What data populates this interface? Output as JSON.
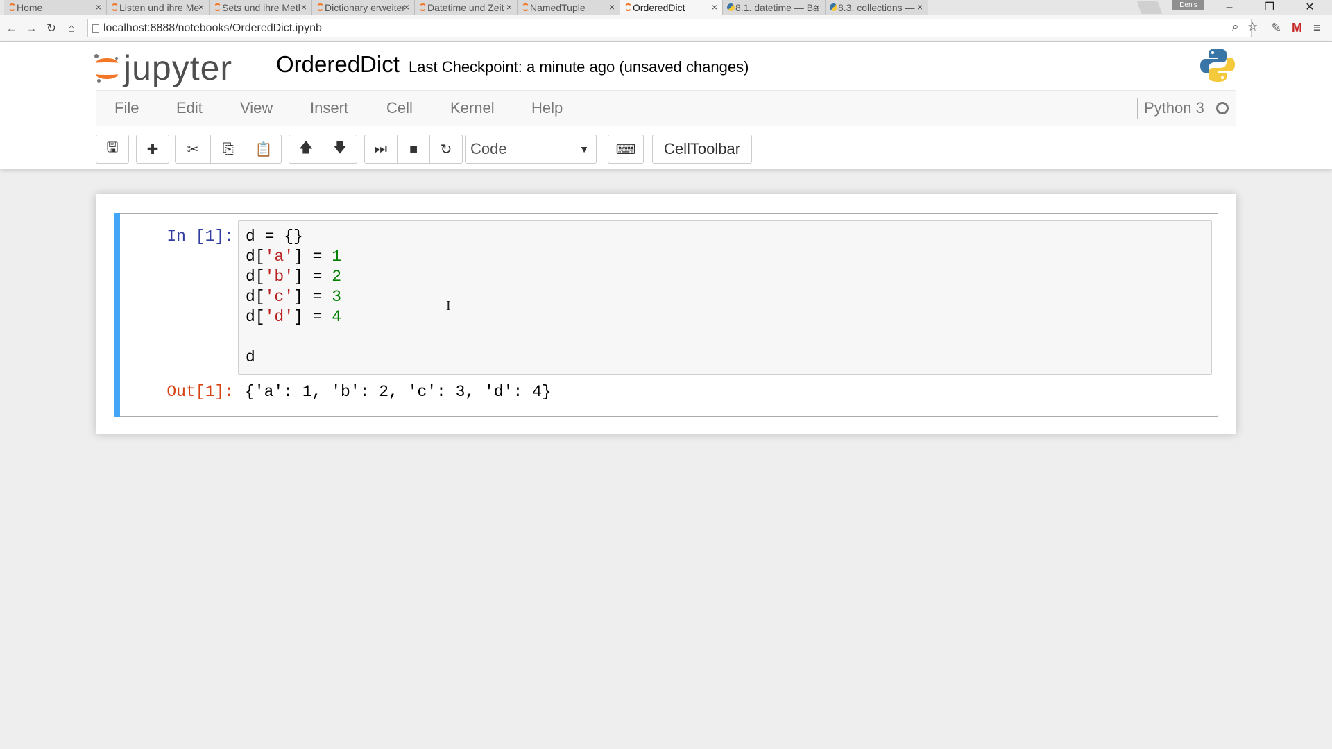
{
  "browser": {
    "tabs": [
      {
        "label": "Home",
        "icon": "jupyter",
        "active": false
      },
      {
        "label": "Listen und ihre Me",
        "icon": "jupyter",
        "active": false
      },
      {
        "label": "Sets und ihre Metl",
        "icon": "jupyter",
        "active": false
      },
      {
        "label": "Dictionary erweiter",
        "icon": "jupyter",
        "active": false
      },
      {
        "label": "Datetime und Zeit",
        "icon": "jupyter",
        "active": false
      },
      {
        "label": "NamedTuple",
        "icon": "jupyter",
        "active": false
      },
      {
        "label": "OrderedDict",
        "icon": "jupyter",
        "active": true
      },
      {
        "label": "8.1. datetime — Ba",
        "icon": "python",
        "active": false
      },
      {
        "label": "8.3. collections —",
        "icon": "python",
        "active": false
      }
    ],
    "tab_close_glyph": "×",
    "user_badge": "Denis",
    "url": "localhost:8888/notebooks/OrderedDict.ipynb",
    "window_controls": {
      "minimize": "–",
      "restore": "❐",
      "close": "✕"
    }
  },
  "header": {
    "logo_text": "jupyter",
    "notebook_name": "OrderedDict",
    "checkpoint": "Last Checkpoint: a minute ago (unsaved changes)"
  },
  "menubar": {
    "items": [
      "File",
      "Edit",
      "View",
      "Insert",
      "Cell",
      "Kernel",
      "Help"
    ],
    "kernel_name": "Python 3"
  },
  "toolbar": {
    "buttons": [
      {
        "name": "save-icon",
        "glyph": "🖫"
      },
      {
        "name": "insert-cell-icon",
        "glyph": "✚"
      },
      {
        "name": "cut-icon",
        "glyph": "✂"
      },
      {
        "name": "copy-icon",
        "glyph": "⎘"
      },
      {
        "name": "paste-icon",
        "glyph": "📋"
      },
      {
        "name": "move-up-icon",
        "glyph": "🡅"
      },
      {
        "name": "move-down-icon",
        "glyph": "🡇"
      },
      {
        "name": "run-icon",
        "glyph": "⏭"
      },
      {
        "name": "stop-icon",
        "glyph": "■"
      },
      {
        "name": "restart-icon",
        "glyph": "↻"
      }
    ],
    "cell_type": "Code",
    "keyboard_glyph": "⌨",
    "celltoolbar_label": "CellToolbar"
  },
  "cell": {
    "in_prompt": "In [1]:",
    "code_lines": [
      [
        {
          "t": "d = {}",
          "c": ""
        }
      ],
      [
        {
          "t": "d[",
          "c": ""
        },
        {
          "t": "'a'",
          "c": "str"
        },
        {
          "t": "] = ",
          "c": ""
        },
        {
          "t": "1",
          "c": "num"
        }
      ],
      [
        {
          "t": "d[",
          "c": ""
        },
        {
          "t": "'b'",
          "c": "str"
        },
        {
          "t": "] = ",
          "c": ""
        },
        {
          "t": "2",
          "c": "num"
        }
      ],
      [
        {
          "t": "d[",
          "c": ""
        },
        {
          "t": "'c'",
          "c": "str"
        },
        {
          "t": "] = ",
          "c": ""
        },
        {
          "t": "3",
          "c": "num"
        }
      ],
      [
        {
          "t": "d[",
          "c": ""
        },
        {
          "t": "'d'",
          "c": "str"
        },
        {
          "t": "] = ",
          "c": ""
        },
        {
          "t": "4",
          "c": "num"
        }
      ],
      [
        {
          "t": "",
          "c": ""
        }
      ],
      [
        {
          "t": "d",
          "c": ""
        }
      ]
    ],
    "out_prompt": "Out[1]:",
    "output": "{'a': 1, 'b': 2, 'c': 3, 'd': 4}"
  },
  "colors": {
    "accent": "#42a5f5",
    "in_prompt": "#303f9f",
    "out_prompt": "#d84315",
    "string": "#ba2121",
    "number": "#008000",
    "jupyter_orange": "#f37726"
  }
}
